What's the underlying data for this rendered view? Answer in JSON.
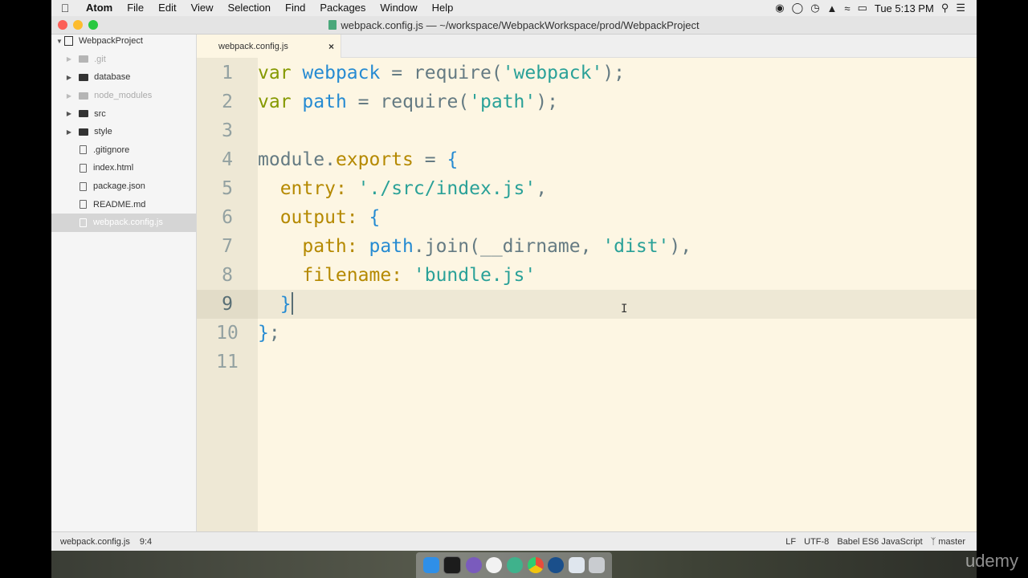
{
  "menubar": {
    "apple_icon": "apple-icon",
    "items": [
      "Atom",
      "File",
      "Edit",
      "View",
      "Selection",
      "Find",
      "Packages",
      "Window",
      "Help"
    ],
    "clock": "Tue 5:13 PM"
  },
  "window": {
    "title": "webpack.config.js — ~/workspace/WebpackWorkspace/prod/WebpackProject"
  },
  "tree": {
    "root": "WebpackProject",
    "items": [
      {
        "label": ".git",
        "type": "folder",
        "dim": true
      },
      {
        "label": "database",
        "type": "folder",
        "dim": false
      },
      {
        "label": "node_modules",
        "type": "folder",
        "dim": true
      },
      {
        "label": "src",
        "type": "folder",
        "dim": false
      },
      {
        "label": "style",
        "type": "folder",
        "dim": false
      },
      {
        "label": ".gitignore",
        "type": "file"
      },
      {
        "label": "index.html",
        "type": "file"
      },
      {
        "label": "package.json",
        "type": "file"
      },
      {
        "label": "README.md",
        "type": "file"
      },
      {
        "label": "webpack.config.js",
        "type": "file",
        "selected": true
      }
    ]
  },
  "tab": {
    "label": "webpack.config.js",
    "close": "×"
  },
  "editor": {
    "line_numbers": [
      "1",
      "2",
      "3",
      "4",
      "5",
      "6",
      "7",
      "8",
      "9",
      "10",
      "11"
    ],
    "current_line": 9
  },
  "status": {
    "file": "webpack.config.js",
    "cursor": "9:4",
    "line_ending": "LF",
    "encoding": "UTF-8",
    "grammar": "Babel ES6 JavaScript",
    "branch": "master"
  },
  "watermark": "udemy"
}
